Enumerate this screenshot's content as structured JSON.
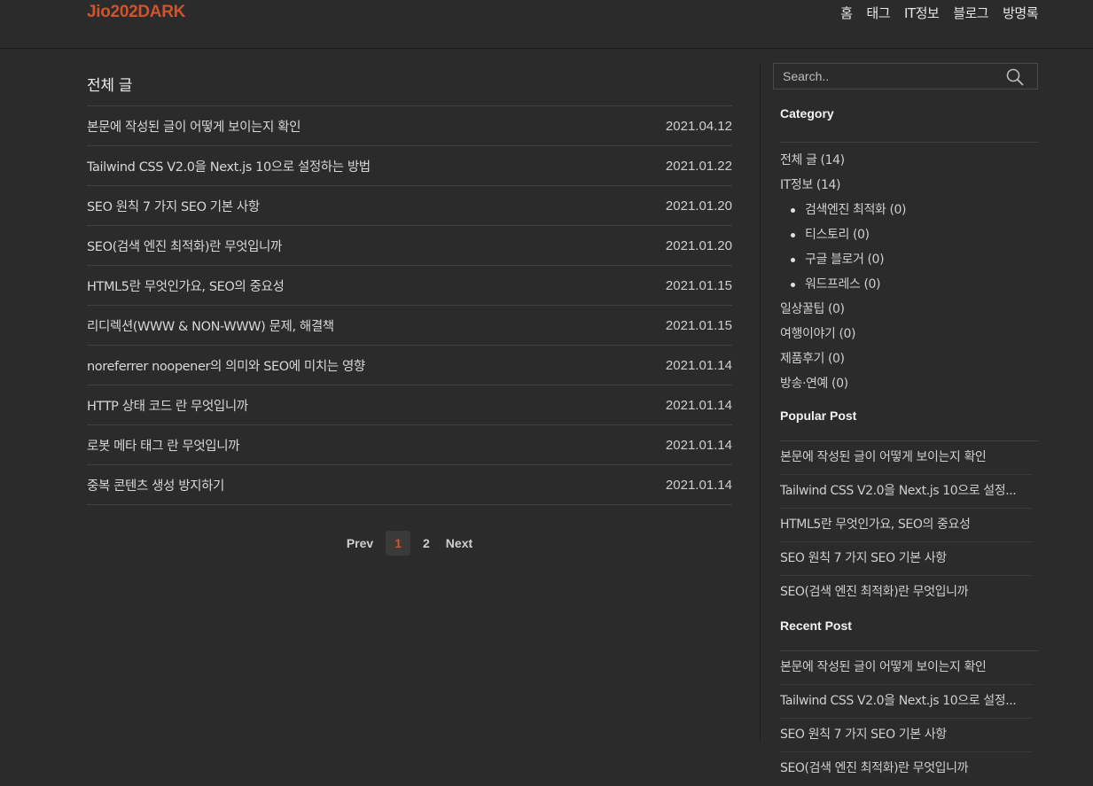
{
  "header": {
    "logo": "Jio202DARK",
    "nav": [
      "홈",
      "태그",
      "IT정보",
      "블로그",
      "방명록"
    ]
  },
  "main": {
    "heading": "전체 글",
    "posts": [
      {
        "title": "본문에 작성된 글이 어떻게 보이는지 확인",
        "date": "2021.04.12"
      },
      {
        "title": "Tailwind CSS V2.0을 Next.js 10으로 설정하는 방법",
        "date": "2021.01.22"
      },
      {
        "title": "SEO 원칙 7 가지 SEO 기본 사항",
        "date": "2021.01.20"
      },
      {
        "title": "SEO(검색 엔진 최적화)란 무엇입니까",
        "date": "2021.01.20"
      },
      {
        "title": "HTML5란 무엇인가요, SEO의 중요성",
        "date": "2021.01.15"
      },
      {
        "title": "리디렉션(WWW & NON-WWW) 문제, 해결책",
        "date": "2021.01.15"
      },
      {
        "title": "noreferrer noopener의 의미와 SEO에 미치는 영향",
        "date": "2021.01.14"
      },
      {
        "title": "HTTP 상태 코드 란 무엇입니까",
        "date": "2021.01.14"
      },
      {
        "title": "로봇 메타 태그 란 무엇입니까",
        "date": "2021.01.14"
      },
      {
        "title": "중복 콘텐츠 생성 방지하기",
        "date": "2021.01.14"
      }
    ],
    "pagination": {
      "prev": "Prev",
      "pages": [
        "1",
        "2"
      ],
      "current": "1",
      "next": "Next"
    }
  },
  "sidebar": {
    "search": {
      "placeholder": "Search..",
      "icon": "search-icon"
    },
    "category": {
      "heading": "Category",
      "items": [
        {
          "label": "전체 글 (14)",
          "sub": false
        },
        {
          "label": "IT정보 (14)",
          "sub": false
        },
        {
          "label": "검색엔진 최적화 (0)",
          "sub": true
        },
        {
          "label": "티스토리 (0)",
          "sub": true
        },
        {
          "label": "구글 블로거 (0)",
          "sub": true
        },
        {
          "label": "워드프레스 (0)",
          "sub": true
        },
        {
          "label": "일상꿀팁 (0)",
          "sub": false
        },
        {
          "label": "여행이야기 (0)",
          "sub": false
        },
        {
          "label": "제품후기 (0)",
          "sub": false
        },
        {
          "label": "방송·연예 (0)",
          "sub": false
        }
      ]
    },
    "popular": {
      "heading": "Popular Post",
      "items": [
        "본문에 작성된 글이 어떻게 보이는지 확인",
        "Tailwind CSS V2.0을 Next.js 10으로 설정...",
        "HTML5란 무엇인가요, SEO의 중요성",
        "SEO 원칙 7 가지 SEO 기본 사항",
        "SEO(검색 엔진 최적화)란 무엇입니까"
      ]
    },
    "recent": {
      "heading": "Recent Post",
      "items": [
        "본문에 작성된 글이 어떻게 보이는지 확인",
        "Tailwind CSS V2.0을 Next.js 10으로 설정...",
        "SEO 원칙 7 가지 SEO 기본 사항",
        "SEO(검색 엔진 최적화)란 무엇입니까"
      ]
    }
  },
  "colors": {
    "background": "#2b2b2b",
    "accent": "#d0532c",
    "text": "#d0d0d0"
  }
}
